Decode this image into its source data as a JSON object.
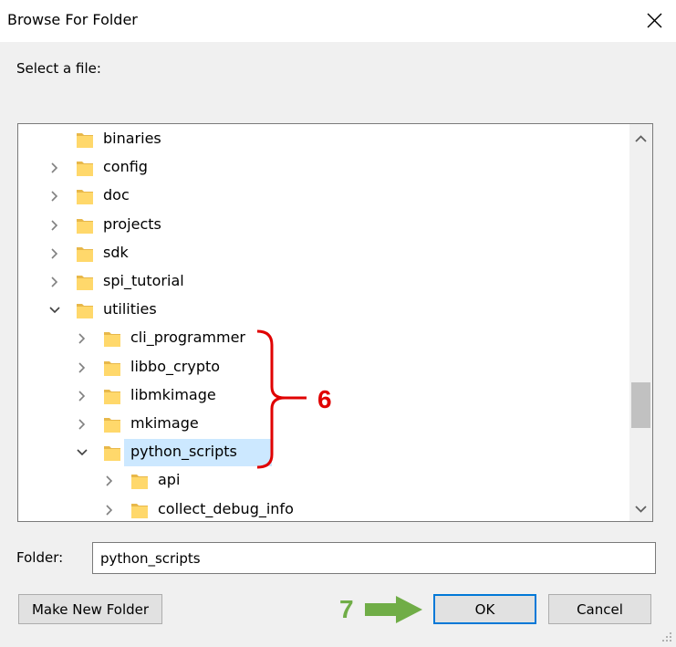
{
  "window": {
    "title": "Browse For Folder"
  },
  "prompt": "Select a file:",
  "tree": {
    "items": [
      {
        "label": "binaries",
        "expander": "none",
        "level": 0,
        "selected": false
      },
      {
        "label": "config",
        "expander": "collapsed",
        "level": 0,
        "selected": false
      },
      {
        "label": "doc",
        "expander": "collapsed",
        "level": 0,
        "selected": false
      },
      {
        "label": "projects",
        "expander": "collapsed",
        "level": 0,
        "selected": false
      },
      {
        "label": "sdk",
        "expander": "collapsed",
        "level": 0,
        "selected": false
      },
      {
        "label": "spi_tutorial",
        "expander": "collapsed",
        "level": 0,
        "selected": false
      },
      {
        "label": "utilities",
        "expander": "expanded",
        "level": 0,
        "selected": false
      },
      {
        "label": "cli_programmer",
        "expander": "collapsed",
        "level": 1,
        "selected": false
      },
      {
        "label": "libbo_crypto",
        "expander": "collapsed",
        "level": 1,
        "selected": false
      },
      {
        "label": "libmkimage",
        "expander": "collapsed",
        "level": 1,
        "selected": false
      },
      {
        "label": "mkimage",
        "expander": "collapsed",
        "level": 1,
        "selected": false
      },
      {
        "label": "python_scripts",
        "expander": "expanded",
        "level": 1,
        "selected": true
      },
      {
        "label": "api",
        "expander": "collapsed",
        "level": 2,
        "selected": false
      },
      {
        "label": "collect_debug_info",
        "expander": "collapsed",
        "level": 2,
        "selected": false
      }
    ]
  },
  "folder": {
    "label": "Folder:",
    "value": "python_scripts"
  },
  "buttons": {
    "make_new_folder": "Make New Folder",
    "ok": "OK",
    "cancel": "Cancel"
  },
  "annotations": {
    "bracket_number": "6",
    "arrow_number": "7"
  },
  "colors": {
    "selection": "#cce8ff",
    "folder_fill": "#ffd86b",
    "folder_dark": "#e8b84a",
    "annotation_red": "#e00000",
    "annotation_green": "#70ad47",
    "default_button_border": "#0078d7"
  },
  "icons": {
    "close": "close-x-icon",
    "folder": "folder-icon",
    "collapsed": "chevron-right-icon",
    "expanded": "chevron-down-icon",
    "scroll_up": "scroll-up-arrow-icon",
    "scroll_down": "scroll-down-arrow-icon"
  }
}
